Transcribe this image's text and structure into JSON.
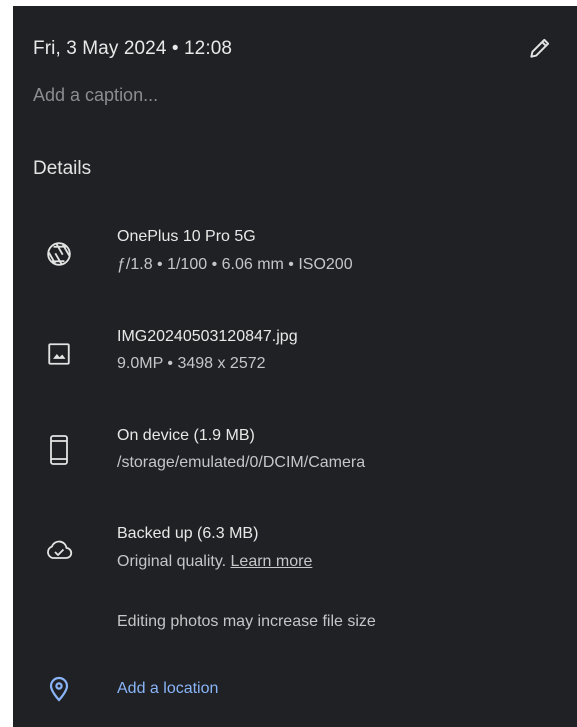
{
  "header": {
    "date_time": "Fri, 3 May 2024 • 12:08",
    "edit_icon": "pencil-icon"
  },
  "caption": {
    "placeholder": "Add a caption..."
  },
  "details": {
    "title": "Details",
    "camera": {
      "icon": "camera-shutter-icon",
      "model": "OnePlus 10 Pro 5G",
      "specs": "ƒ/1.8 • 1/100 • 6.06 mm • ISO200"
    },
    "file": {
      "icon": "image-icon",
      "name": "IMG20240503120847.jpg",
      "info": "9.0MP • 3498 x 2572"
    },
    "storage": {
      "icon": "phone-icon",
      "title": "On device (1.9 MB)",
      "path": "/storage/emulated/0/DCIM/Camera"
    },
    "backup": {
      "icon": "cloud-done-icon",
      "title": "Backed up (6.3 MB)",
      "quality_prefix": "Original quality. ",
      "learn_more": "Learn more"
    },
    "note": "Editing photos may increase file size",
    "location": {
      "icon": "location-pin-icon",
      "label": "Add a location"
    }
  },
  "colors": {
    "background": "#1f2124",
    "text_primary": "#e8e8e8",
    "text_secondary": "#c4c6c8",
    "placeholder": "#8b8d90",
    "accent": "#8ab4f8"
  }
}
